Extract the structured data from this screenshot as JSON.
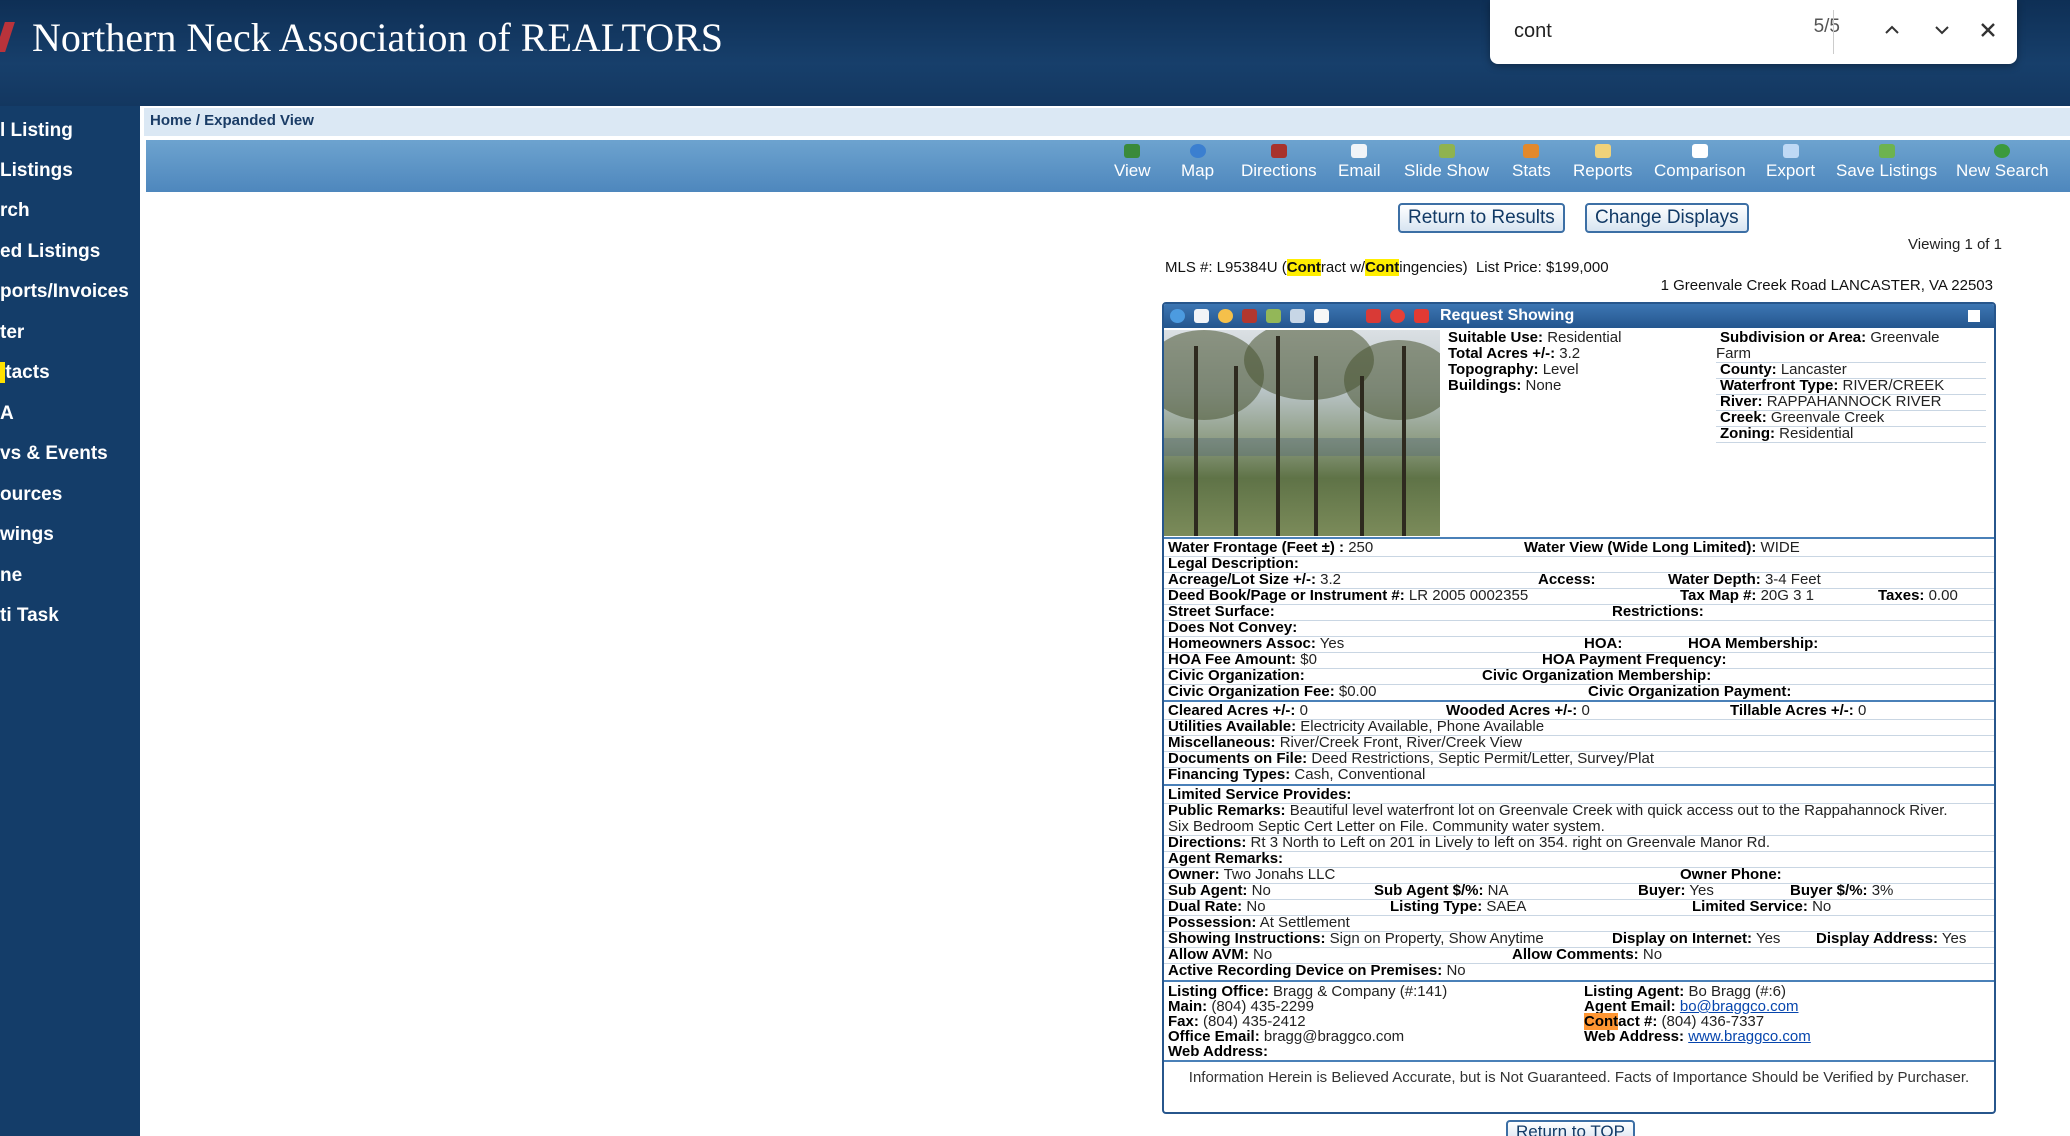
{
  "header": {
    "title": "Northern Neck Association of REALTORS"
  },
  "find_bar": {
    "query": "cont",
    "count": "5/5"
  },
  "left_nav": {
    "items": [
      "l Listing",
      "Listings",
      "rch",
      "ed Listings",
      "ports/Invoices",
      "ter",
      "tacts",
      "A",
      "vs & Events",
      "ources",
      "wings",
      "ne",
      "ti Task"
    ]
  },
  "breadcrumb": "Home / Expanded View",
  "toolbar": {
    "items": [
      "View",
      "Map",
      "Directions",
      "Email",
      "Slide Show",
      "Stats",
      "Reports",
      "Comparison",
      "Export",
      "Save Listings",
      "New Search"
    ]
  },
  "buttons": {
    "return_results": "Return to Results",
    "change_displays": "Change Displays",
    "return_top": "Return to TOP"
  },
  "viewing": "Viewing 1 of 1",
  "listing": {
    "mls_prefix": "MLS #: L95384U (",
    "status_m1": "Cont",
    "status_mid": "ract w/",
    "status_m2": "Cont",
    "status_end": "ingencies)",
    "price": "List Price: $199,000",
    "address": "1 Greenvale Creek Road LANCASTER, VA 22503",
    "request_showing": "Request Showing",
    "summary_left": [
      {
        "label": "Suitable Use:",
        "value": "Residential"
      },
      {
        "label": "Total Acres +/-:",
        "value": "3.2"
      },
      {
        "label": "Topography:",
        "value": "Level"
      },
      {
        "label": "Buildings:",
        "value": "None"
      }
    ],
    "summary_right": [
      {
        "label": "Subdivision or Area:",
        "value": "Greenvale"
      },
      {
        "label": "",
        "value": "Farm"
      },
      {
        "label": "County:",
        "value": "Lancaster"
      },
      {
        "label": "Waterfront Type:",
        "value": "RIVER/CREEK"
      },
      {
        "label": "River:",
        "value": "RAPPAHANNOCK RIVER"
      },
      {
        "label": "Creek:",
        "value": "Greenvale Creek"
      },
      {
        "label": "Zoning:",
        "value": "Residential"
      }
    ],
    "f": {
      "water_frontage": {
        "label": "Water Frontage (Feet ±) :",
        "value": "250"
      },
      "water_view": {
        "label": "Water View (Wide Long Limited):",
        "value": "WIDE"
      },
      "legal": {
        "label": "Legal Description:",
        "value": ""
      },
      "acreage": {
        "label": "Acreage/Lot Size +/-:",
        "value": "3.2"
      },
      "access": {
        "label": "Access:",
        "value": ""
      },
      "water_depth": {
        "label": "Water Depth:",
        "value": "3-4 Feet"
      },
      "deed": {
        "label": "Deed Book/Page or Instrument #:",
        "value": "LR 2005 0002355"
      },
      "tax_map": {
        "label": "Tax Map #:",
        "value": "20G 3 1"
      },
      "taxes": {
        "label": "Taxes:",
        "value": "0.00"
      },
      "street": {
        "label": "Street Surface:",
        "value": ""
      },
      "restrictions": {
        "label": "Restrictions:",
        "value": ""
      },
      "not_convey": {
        "label": "Does Not Convey:",
        "value": ""
      },
      "hoa_assoc": {
        "label": "Homeowners Assoc:",
        "value": "Yes"
      },
      "hoa": {
        "label": "HOA:",
        "value": ""
      },
      "hoa_membership": {
        "label": "HOA Membership:",
        "value": ""
      },
      "hoa_fee": {
        "label": "HOA Fee Amount:",
        "value": "$0"
      },
      "hoa_freq": {
        "label": "HOA Payment Frequency:",
        "value": ""
      },
      "civic_org": {
        "label": "Civic Organization:",
        "value": ""
      },
      "civic_member": {
        "label": "Civic Organization Membership:",
        "value": ""
      },
      "civic_fee": {
        "label": "Civic Organization Fee:",
        "value": "$0.00"
      },
      "civic_pay": {
        "label": "Civic Organization Payment:",
        "value": ""
      },
      "cleared": {
        "label": "Cleared Acres +/-:",
        "value": "0"
      },
      "wooded": {
        "label": "Wooded Acres +/-:",
        "value": "0"
      },
      "tillable": {
        "label": "Tillable Acres +/-:",
        "value": "0"
      },
      "utilities": {
        "label": "Utilities Available:",
        "value": "Electricity Available, Phone Available"
      },
      "misc": {
        "label": "Miscellaneous:",
        "value": "River/Creek Front, River/Creek View"
      },
      "docs": {
        "label": "Documents on File:",
        "value": "Deed Restrictions, Septic Permit/Letter, Survey/Plat"
      },
      "financing": {
        "label": "Financing Types:",
        "value": "Cash, Conventional"
      },
      "limited_service": {
        "label": "Limited Service Provides:",
        "value": ""
      },
      "public_remarks": {
        "label": "Public Remarks:",
        "value": "Beautiful level waterfront lot on Greenvale Creek with quick access out to the Rappahannock River."
      },
      "public_remarks_2": "Six Bedroom Septic Cert Letter on File. Community water system.",
      "directions": {
        "label": "Directions:",
        "value": "Rt 3 North to Left on 201 in Lively to left on 354. right on Greenvale Manor Rd."
      },
      "agent_remarks": {
        "label": "Agent Remarks:",
        "value": ""
      },
      "owner": {
        "label": "Owner:",
        "value": "Two Jonahs LLC"
      },
      "owner_phone": {
        "label": "Owner Phone:",
        "value": ""
      },
      "sub_agent": {
        "label": "Sub Agent:",
        "value": "No"
      },
      "sub_agent_pct": {
        "label": "Sub Agent $/%:",
        "value": "NA"
      },
      "buyer": {
        "label": "Buyer:",
        "value": "Yes"
      },
      "buyer_pct": {
        "label": "Buyer $/%:",
        "value": "3%"
      },
      "dual_rate": {
        "label": "Dual Rate:",
        "value": "No"
      },
      "listing_type": {
        "label": "Listing Type:",
        "value": "SAEA"
      },
      "limited_service_2": {
        "label": "Limited Service:",
        "value": "No"
      },
      "possession": {
        "label": "Possession:",
        "value": "At Settlement"
      },
      "showing": {
        "label": "Showing Instructions:",
        "value": "Sign on Property, Show Anytime"
      },
      "display_internet": {
        "label": "Display on Internet:",
        "value": "Yes"
      },
      "display_address": {
        "label": "Display Address:",
        "value": "Yes"
      },
      "allow_avm": {
        "label": "Allow AVM:",
        "value": "No"
      },
      "allow_comments": {
        "label": "Allow Comments:",
        "value": "No"
      },
      "recording": {
        "label": "Active Recording Device on Premises:",
        "value": "No"
      }
    },
    "office": {
      "listing_office": {
        "label": "Listing Office:",
        "value": "Bragg & Company (#:141)"
      },
      "main": {
        "label": "Main:",
        "value": "(804) 435-2299"
      },
      "fax": {
        "label": "Fax:",
        "value": "(804) 435-2412"
      },
      "office_email": {
        "label": "Office Email:",
        "value": "bragg@braggco.com"
      },
      "web_address": {
        "label": "Web Address:",
        "value": ""
      },
      "listing_agent": {
        "label": "Listing Agent:",
        "value": "Bo Bragg (#:6)"
      },
      "agent_email": {
        "label": "Agent Email:",
        "value": "bo@braggco.com"
      },
      "contact_m": "Cont",
      "contact_label": "act #:",
      "contact_value": "(804) 436-7337",
      "agent_web": {
        "label": "Web Address:",
        "value": "www.braggco.com"
      }
    },
    "disclaimer": "Information Herein is Believed Accurate, but is Not Guaranteed. Facts of Importance Should be Verified by Purchaser."
  },
  "colors": {
    "header_bg": "#143d69",
    "toolbar_bg": "#5a94c8",
    "highlight": "#ffee00",
    "current_highlight": "#ff9632"
  }
}
